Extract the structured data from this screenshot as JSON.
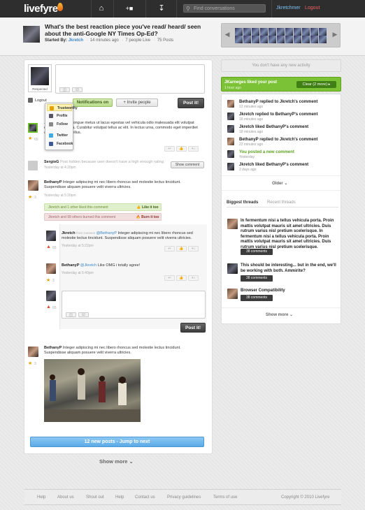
{
  "app": {
    "logo": "livefyre"
  },
  "topbar": {
    "search_placeholder": "Find conversations",
    "user": "Jkretchmer",
    "logout": "Logout"
  },
  "header": {
    "title": "What's the best reaction piece you've read/ heard/ seen about the anti-Google NY Times Op-Ed?",
    "started_by_label": "Started By:",
    "started_by": "Jkretch",
    "time": "14 minutes ago",
    "live": "7 people Live",
    "posts": "75 Posts"
  },
  "composer": {
    "avatar_label": "Respected",
    "logout": "Logout",
    "notifications": "Notifications on",
    "invite": "Invite people",
    "post": "Post it!"
  },
  "dropdown": {
    "items": [
      "Trustworthy",
      "Profile",
      "Follow",
      "Twitter",
      "Facebook"
    ]
  },
  "posts": [
    {
      "text": "... lectus. Morbi congue metus ut lacus egestas vel vehicula odio malesuada elit volutpat dui tincidunt porta. Curabitur volutpat tellus ac elit. In lectus urna, commodo eget imperdiet a, sodales eget tellus.",
      "count": "65"
    },
    {
      "name": "SergioG",
      "text": "Post hidden because user doesn't have a high enough rating.",
      "time": "Yesterday at 4:20pm",
      "show": "Show comment"
    },
    {
      "name": "BethanyP",
      "text": "Integer adipiscing mi nec libero rhoncus sed molestie lectus tincidunt. Suspendisse aliquam posuere velit viverra ultricies.",
      "time": "Yesterday at 5:20pm",
      "count": "3",
      "liked": "Jkretch and 1 other liked this comment",
      "like": "Like it too",
      "burned": "Jkretch and 99 others burned this comment",
      "burn": "Burn it too"
    },
    {
      "name": "Jkretch",
      "from": "from Connect",
      "mention": "@BethanyP",
      "text": "Integer adipiscing mi nec libero rhoncus sed molestie lectus tincidunt. Suspendisse aliquam posuere velit viverra ultricies.",
      "time": "Yesterday at 5:22pm",
      "count": "65"
    },
    {
      "name": "BethanyP",
      "mention": "@Jkretch",
      "text": "Like OMG i totally agree!",
      "time": "Yesterday at 5:40pm",
      "count": "3"
    },
    {
      "name": "BethanyP",
      "text": "Integer adipiscing mi nec libero rhoncus sed molestie lectus tincidunt. Suspendisse aliquam posuere velit viverra ultricies.",
      "count": "3"
    }
  ],
  "subreply": {
    "count": "65",
    "post": "Post it!"
  },
  "jump": "12 new posts - Jump to next",
  "show_more": "Show more",
  "activity": {
    "none": "You don't have any new activity",
    "notif_title": "JKarneges liked your post",
    "notif_time": "1 hour ago",
    "clear": "Clear (2 more)",
    "feed": [
      {
        "t": "BethanyP replied to Jkretch's comment",
        "s": "12 minutes ago"
      },
      {
        "t": "Jkretch replied to BethanyP's comment",
        "s": "16 minutes ago"
      },
      {
        "t": "Jkretch liked BethanyP's comment",
        "s": "18 minutes ago"
      },
      {
        "t": "BethanyP replied to Jkretch's comment",
        "s": "22 minutes ago"
      },
      {
        "t": "You posted a new comment",
        "s": "Yesterday"
      },
      {
        "t": "Jkretch liked BethanyP's comment",
        "s": "2 days ago"
      }
    ],
    "older": "Older",
    "tab_biggest": "Biggest threads",
    "tab_recent": "Recent threads",
    "threads": [
      {
        "t": "In fermentum nisi a tellus vehicula porta. Proin mattis volutpat mauris sit amet ultricies. Duis rutrum varius nisl pretium scelerisque. In fermentum nisi a tellus vehicula porta. Proin mattis volutpat mauris sit amet ultricies. Duis rutrum varius nisl pretium scelerisque.",
        "c": "38 comments"
      },
      {
        "t": "This should be interesting... but in the end, we'll be working with both. Ammirite?",
        "c": "38 comments"
      },
      {
        "t": "Browser Compatibility",
        "c": "38 comments"
      }
    ],
    "show_more": "Show more"
  },
  "footer": {
    "links": [
      "Help",
      "About us",
      "Shout out",
      "Help",
      "Contact us",
      "Privacy guidelines",
      "Terms of use"
    ],
    "copyright": "Copyright © 2010 Livefyre"
  }
}
